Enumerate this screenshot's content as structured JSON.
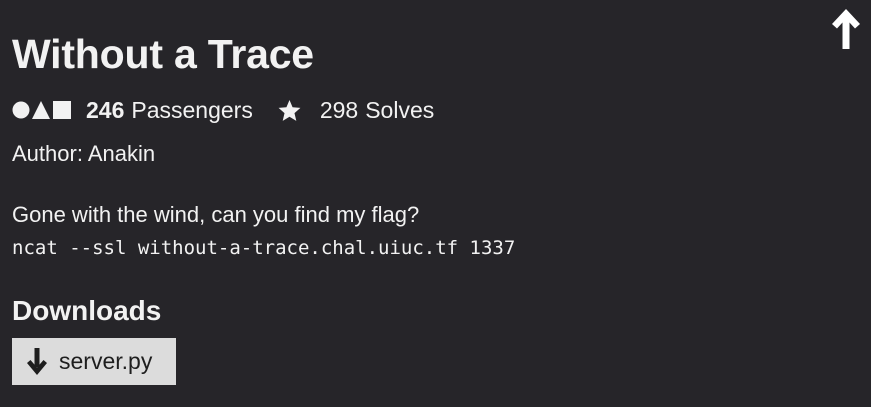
{
  "challenge": {
    "title": "Without a Trace",
    "passengers_count": "246",
    "passengers_label": "Passengers",
    "solves_count": "298",
    "solves_label": "Solves",
    "author": "Author: Anakin",
    "description": "Gone with the wind, can you find my flag?",
    "command": "ncat --ssl without-a-trace.chal.uiuc.tf 1337"
  },
  "downloads": {
    "heading": "Downloads",
    "files": [
      {
        "name": "server.py",
        "icon": "download-arrow-icon"
      }
    ]
  },
  "icons": {
    "category": "circle-triangle-square-icon",
    "solves": "star-icon",
    "scroll_top": "arrow-up-icon"
  },
  "colors": {
    "background": "#262529",
    "text": "#f2f2f2",
    "button_bg": "#dcdcdc",
    "button_text": "#1e1e1e"
  }
}
